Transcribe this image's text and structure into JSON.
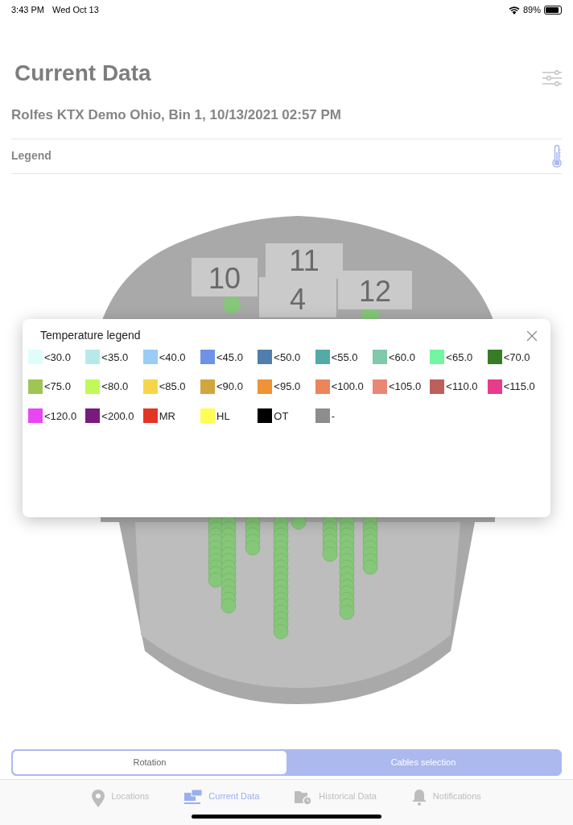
{
  "status_bar": {
    "time": "3:43 PM",
    "date": "Wed Oct 13",
    "battery_text": "89%",
    "battery": {
      "level": 0.89
    }
  },
  "header": {
    "title": "Current Data",
    "subtitle": "Rolfes KTX Demo Ohio, Bin 1, 10/13/2021 02:57 PM"
  },
  "legend_row": {
    "label": "Legend"
  },
  "bin_view": {
    "cable_labels": [
      {
        "text": "10"
      },
      {
        "text": "11"
      },
      {
        "text": "4"
      },
      {
        "text": "12"
      }
    ]
  },
  "legend_dialog": {
    "title": "Temperature legend",
    "items": [
      {
        "label": "<30.0",
        "color": "#e0fdfc"
      },
      {
        "label": "<35.0",
        "color": "#b8e9ea"
      },
      {
        "label": "<40.0",
        "color": "#9accf5"
      },
      {
        "label": "<45.0",
        "color": "#6e93e6"
      },
      {
        "label": "<50.0",
        "color": "#507fae"
      },
      {
        "label": "<55.0",
        "color": "#53aba6"
      },
      {
        "label": "<60.0",
        "color": "#80c9ab"
      },
      {
        "label": "<65.0",
        "color": "#73f5a2"
      },
      {
        "label": "<70.0",
        "color": "#367c24"
      },
      {
        "label": "<75.0",
        "color": "#9fc554"
      },
      {
        "label": "<80.0",
        "color": "#c0f95a"
      },
      {
        "label": "<85.0",
        "color": "#f7d54a"
      },
      {
        "label": "<90.0",
        "color": "#d2a63f"
      },
      {
        "label": "<95.0",
        "color": "#ef9334"
      },
      {
        "label": "<100.0",
        "color": "#ec855a"
      },
      {
        "label": "<105.0",
        "color": "#ea8675"
      },
      {
        "label": "<110.0",
        "color": "#bd5f5c"
      },
      {
        "label": "<115.0",
        "color": "#e73b8c"
      },
      {
        "label": "<120.0",
        "color": "#e946f3"
      },
      {
        "label": "<200.0",
        "color": "#781b7d"
      },
      {
        "label": "MR",
        "color": "#e43423"
      },
      {
        "label": "HL",
        "color": "#fefe54"
      },
      {
        "label": "OT",
        "color": "#000000"
      },
      {
        "label": "-",
        "color": "#8d8d90"
      }
    ]
  },
  "segmented": [
    {
      "label": "Rotation",
      "selected": true
    },
    {
      "label": "Cables selection",
      "selected": false
    }
  ],
  "tab_bar": [
    {
      "label": "Locations",
      "kind": "pin",
      "selected": false
    },
    {
      "label": "Current Data",
      "kind": "live",
      "selected": true
    },
    {
      "label": "Historical Data",
      "kind": "folder",
      "selected": false
    },
    {
      "label": "Notifications",
      "kind": "bell",
      "selected": false
    }
  ]
}
